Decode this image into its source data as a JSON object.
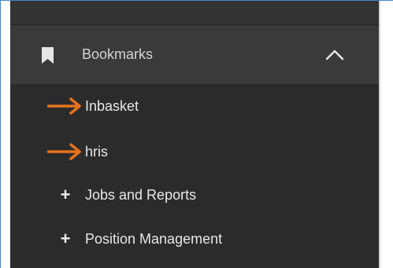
{
  "bookmarks": {
    "title": "Bookmarks",
    "expanded": true,
    "items": [
      {
        "label": "Inbasket",
        "marker": "arrow-icon"
      },
      {
        "label": "hris",
        "marker": "arrow-icon"
      },
      {
        "label": "Jobs and Reports",
        "marker": "plus-icon",
        "glyph": "+"
      },
      {
        "label": "Position Management",
        "marker": "plus-icon",
        "glyph": "+"
      }
    ]
  },
  "colors": {
    "sidebar_bg": "#2b2b2b",
    "header_bg": "#3a3a3a",
    "arrow": "#e8721c",
    "text": "#e8e8e8",
    "frame_border": "#4a86c8"
  }
}
